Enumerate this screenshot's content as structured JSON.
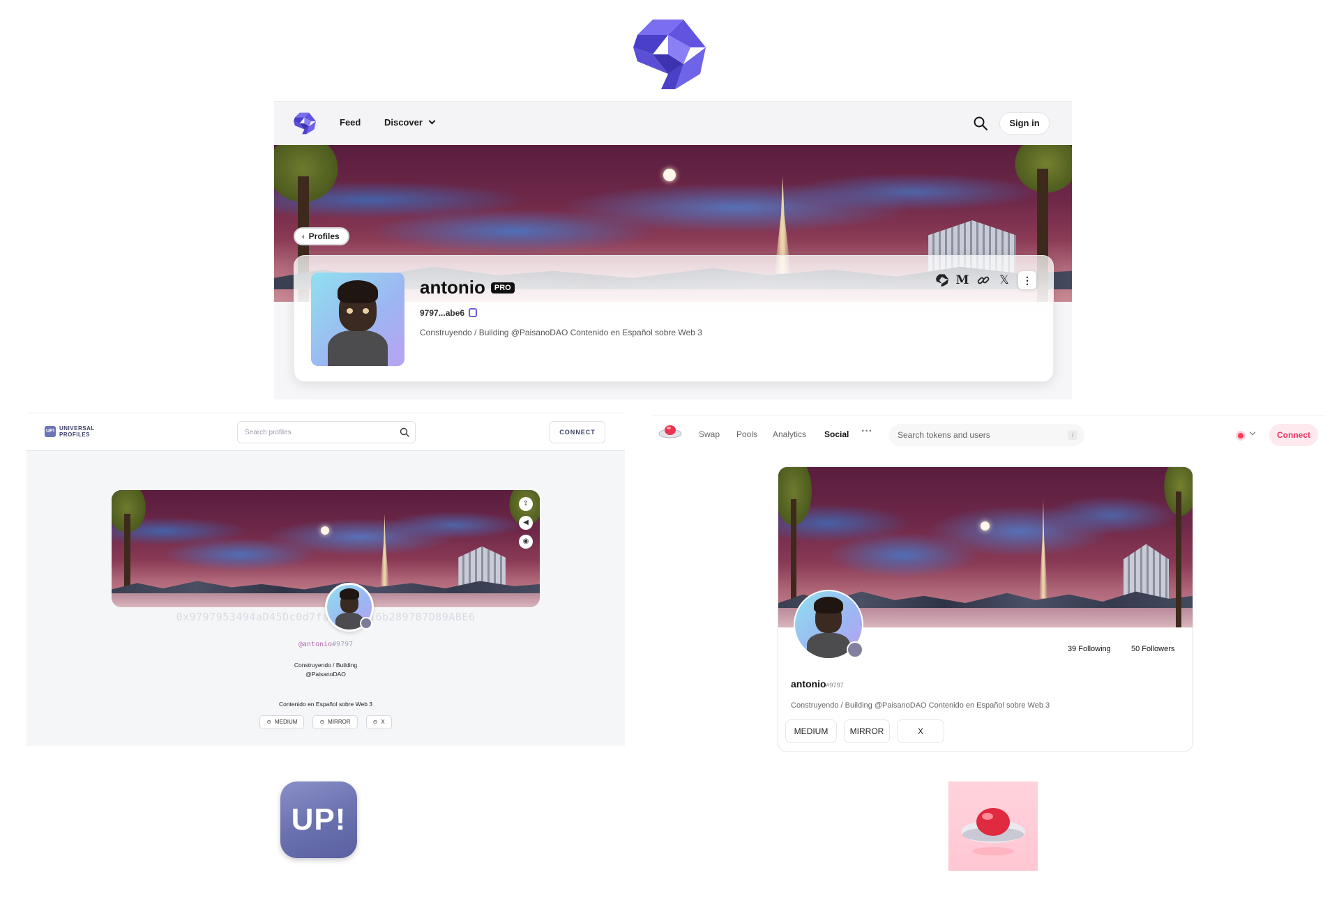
{
  "panel1": {
    "nav": {
      "feed": "Feed",
      "discover": "Discover",
      "signin": "Sign in"
    },
    "back_label": "Profiles",
    "profile": {
      "name": "antonio",
      "badge": "PRO",
      "address": "9797...abe6",
      "bio": "Construyendo / Building @PaisanoDAO Contenido en Español sobre Web 3",
      "icons": [
        "common-logo-icon",
        "medium-icon",
        "link-icon",
        "x-icon",
        "more-icon"
      ],
      "medium_glyph": "M",
      "x_glyph": "𝕏",
      "more_glyph": "⋮"
    },
    "accent": "#5b4fd6"
  },
  "panel2": {
    "brand_line1": "UNIVERSAL",
    "brand_line2": "PROFILES",
    "logo_text": "UP!",
    "search_placeholder": "Search profiles",
    "connect": "CONNECT",
    "address": "0x9797953494aD45Dc0d7fa1de3a416b289787D89ABE6",
    "handle_at": "@antonio",
    "handle_hash": "#9797",
    "bio_line1": "Construyendo / Building",
    "bio_line2": "@PaisanoDAO",
    "bio_line3": "Contenido en Español sobre Web 3",
    "links": [
      "MEDIUM",
      "MIRROR",
      "X"
    ],
    "link_glyph": "⊖"
  },
  "panel3": {
    "nav": [
      "Swap",
      "Pools",
      "Analytics",
      "Social"
    ],
    "active_nav": "Social",
    "more": "···",
    "search_placeholder": "Search tokens and users",
    "search_hint": "/",
    "connect": "Connect",
    "following": "39 Following",
    "followers": "50 Followers",
    "name": "antonio",
    "name_hash": "#9797",
    "bio": "Construyendo / Building @PaisanoDAO Contenido en Español sobre Web 3",
    "links": [
      "MEDIUM",
      "MIRROR",
      "X"
    ],
    "accent": "#f03564"
  },
  "app_icons": {
    "up_label": "UP!"
  }
}
